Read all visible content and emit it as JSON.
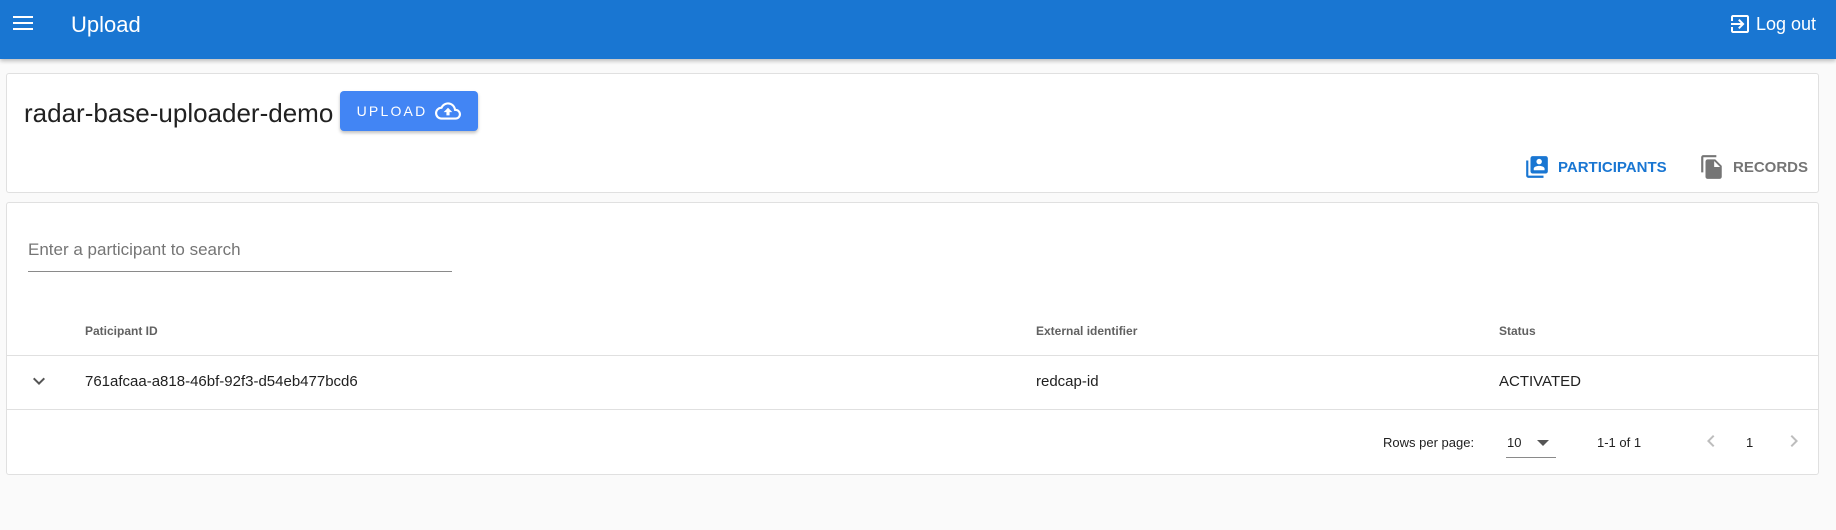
{
  "appbar": {
    "title": "Upload",
    "logout_label": "Log out"
  },
  "project": {
    "name": "radar-base-uploader-demo",
    "upload_label": "UPLOAD"
  },
  "tabs": [
    {
      "label": "PARTICIPANTS",
      "active": true
    },
    {
      "label": "RECORDS",
      "active": false
    }
  ],
  "search": {
    "value": "",
    "placeholder": "Enter a participant to search"
  },
  "table": {
    "columns": [
      "Paticipant ID",
      "External identifier",
      "Status"
    ],
    "rows": [
      {
        "id": "761afcaa-a818-46bf-92f3-d54eb477bcd6",
        "external": "redcap-id",
        "status": "ACTIVATED"
      }
    ]
  },
  "pagination": {
    "rows_per_page_label": "Rows per page:",
    "rows_per_page": "10",
    "range": "1-1 of 1",
    "page": "1"
  },
  "colors": {
    "appbar": "#1976d2",
    "upload_button": "#4285f4",
    "active_tab": "#1976d2",
    "inactive_tab": "#757575"
  },
  "icons": [
    "menu-icon",
    "logout-icon",
    "cloud-upload-icon",
    "participants-icon",
    "records-icon",
    "chevron-down-icon",
    "chevron-left-icon",
    "chevron-right-icon",
    "dropdown-caret-icon"
  ]
}
